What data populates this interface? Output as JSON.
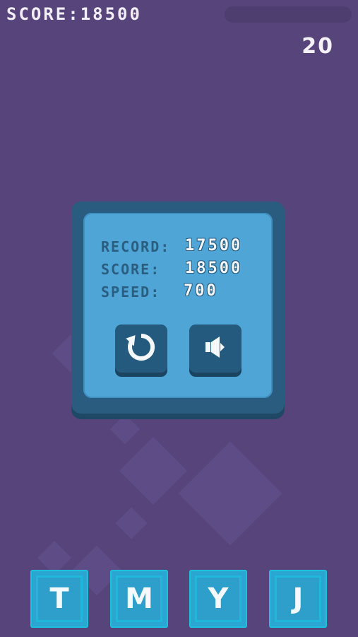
{
  "hud": {
    "score_label": "SCORE:",
    "score_value": "18500",
    "timer": "20"
  },
  "panel": {
    "record_label": "RECORD:",
    "record_value": "17500",
    "score_label": "SCORE:",
    "score_value": "18500",
    "speed_label": "SPEED:",
    "speed_value": "700"
  },
  "buttons": {
    "restart_icon": "restart-icon",
    "sound_icon": "speaker-icon"
  },
  "letters": [
    "T",
    "M",
    "Y",
    "J"
  ],
  "colors": {
    "background": "#57447a",
    "panel_outer": "#2a5c80",
    "panel_inner": "#4fa5d6",
    "letter_tile": "#2aa6d0"
  }
}
